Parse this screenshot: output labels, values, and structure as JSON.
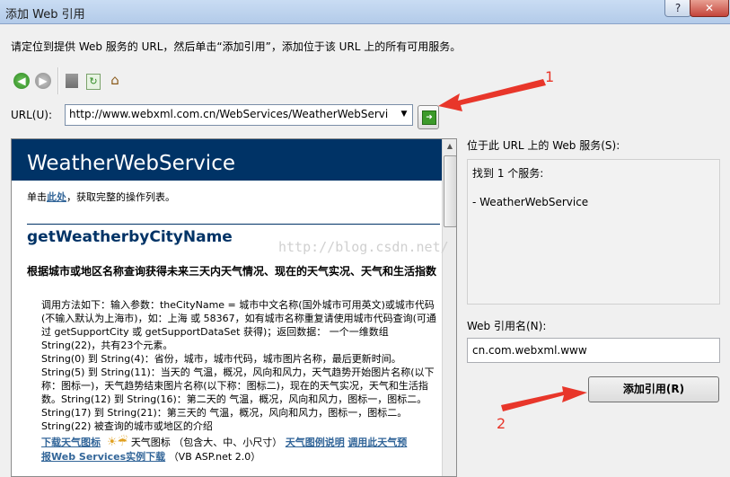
{
  "window": {
    "title": "添加 Web 引用",
    "help_label": "?",
    "close_label": "✕"
  },
  "instructions": "请定位到提供 Web 服务的 URL，然后单击“添加引用”，添加位于该 URL 上的所有可用服务。",
  "toolbar": {
    "back_icon": "back-arrow-icon",
    "forward_icon": "forward-arrow-icon",
    "stop_icon": "stop-icon",
    "refresh_icon": "refresh-icon",
    "home_icon": "home-icon",
    "back_glyph": "◀",
    "forward_glyph": "▶",
    "refresh_glyph": "↻",
    "home_glyph": "⌂"
  },
  "url": {
    "label": "URL(U):",
    "value": "http://www.webxml.com.cn/WebServices/WeatherWebService.a",
    "dropdown_glyph": "▼",
    "go_glyph": "➜"
  },
  "browser": {
    "service_title": "WeatherWebService",
    "ops_prefix": "单击",
    "ops_link": "此处",
    "ops_suffix": "，获取完整的操作列表。",
    "operation_name": "getWeatherbyCityName",
    "operation_heading": "根据城市或地区名称查询获得未来三天内天气情况、现在的天气实况、天气和生活指数",
    "operation_body": "调用方法如下：输入参数：theCityName = 城市中文名称(国外城市可用英文)或城市代码(不输入默认为上海市)，如：上海 或 58367，如有城市名称重复请使用城市代码查询(可通过 getSupportCity 或 getSupportDataSet 获得)；返回数据： 一个一维数组 String(22)，共有23个元素。\nString(0) 到 String(4)：省份，城市，城市代码，城市图片名称，最后更新时间。String(5) 到 String(11)：当天的 气温，概况，风向和风力，天气趋势开始图片名称(以下称：图标一)，天气趋势结束图片名称(以下称：图标二)，现在的天气实况，天气和生活指数。String(12) 到 String(16)：第二天的 气温，概况，风向和风力，图标一，图标二。String(17) 到 String(21)：第三天的 气温，概况，风向和风力，图标一，图标二。String(22) 被查询的城市或地区的介绍",
    "link_download_icons": "下载天气图标",
    "icons_text": "天气图标 （包含大、中、小尺寸）",
    "link_icon_desc": "天气图例说明",
    "link_example_a": "调用此天气预",
    "link_example_b": "报Web Services实例下载",
    "example_suffix": "（VB ASP.net 2.0）",
    "weather_icons": "☀☔"
  },
  "services_panel": {
    "label": "位于此 URL 上的 Web 服务(S):",
    "found_text": "找到 1 个服务:",
    "service_item": "- WeatherWebService"
  },
  "reference": {
    "label": "Web 引用名(N):",
    "value": "cn.com.webxml.www",
    "add_button": "添加引用(R)"
  },
  "annotations": {
    "marker_1": "1",
    "marker_2": "2",
    "color": "#e8362a"
  },
  "watermark": "http://blog.csdn.net/"
}
